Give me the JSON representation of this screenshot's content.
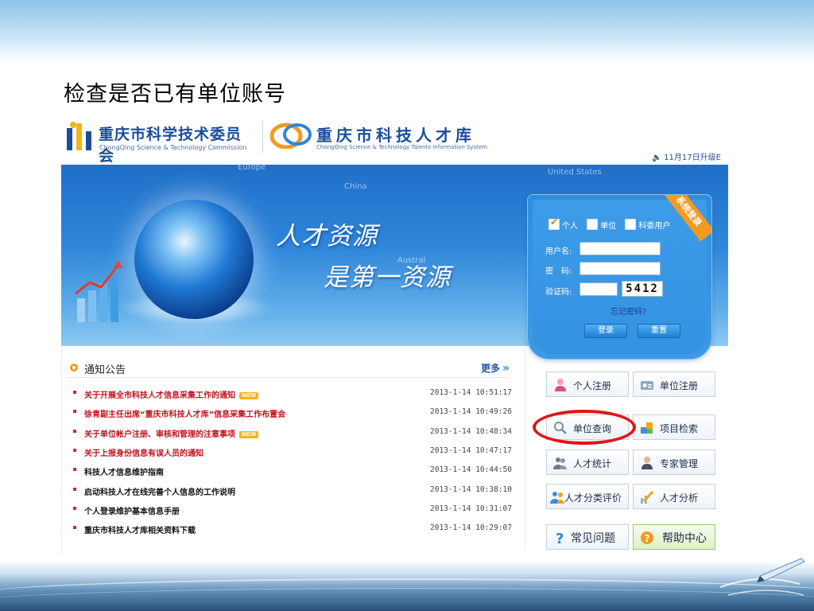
{
  "slide": {
    "title": "检查是否已有单位账号"
  },
  "header": {
    "logo1": {
      "name": "重庆市科学技术委员会",
      "en": "ChongQing Science & Technology Commission"
    },
    "logo2": {
      "name": "重庆市科技人才库",
      "en": "ChongQing Science & Technology Talents Information System"
    },
    "upgrade_notice": "11月17日升级E"
  },
  "banner": {
    "slogan_line1": "人才资源",
    "slogan_line2": "是第一资源",
    "map_labels": [
      "Europe",
      "China",
      "United States",
      "Austral"
    ]
  },
  "login": {
    "ribbon": "系统登录",
    "roles": [
      {
        "label": "个人",
        "checked": true
      },
      {
        "label": "单位",
        "checked": false
      },
      {
        "label": "科委用户",
        "checked": false
      }
    ],
    "username_label": "用户名:",
    "password_label": "密　码:",
    "captcha_label": "验证码:",
    "captcha_code": "5412",
    "forgot": "忘记密码?",
    "login_button": "登录",
    "reset_button": "重置"
  },
  "notices": {
    "title": "通知公告",
    "more": "更多",
    "items": [
      {
        "text": "关于开展全市科技人才信息采集工作的通知",
        "date": "2013-1-14 10:51:17",
        "new": true,
        "red": true
      },
      {
        "text": "徐青副主任出席“重庆市科技人才库”信息采集工作布置会",
        "date": "2013-1-14 10:49:26",
        "new": false,
        "red": true
      },
      {
        "text": "关于单位帐户注册、审核和管理的注意事项",
        "date": "2013-1-14 10:48:34",
        "new": true,
        "red": true
      },
      {
        "text": "关于上报身份信息有误人员的通知",
        "date": "2013-1-14 10:47:17",
        "new": false,
        "red": true
      },
      {
        "text": "科技人才信息维护指南",
        "date": "2013-1-14 10:44:50",
        "new": false,
        "red": false
      },
      {
        "text": "启动科技人才在线完善个人信息的工作说明",
        "date": "2013-1-14 10:38:10",
        "new": false,
        "red": false
      },
      {
        "text": "个人登录维护基本信息手册",
        "date": "2013-1-14 10:31:07",
        "new": false,
        "red": false
      },
      {
        "text": "重庆市科技人才库相关资料下载",
        "date": "2013-1-14 10:29:07",
        "new": false,
        "red": false
      }
    ],
    "new_badge": "NEW"
  },
  "quick": {
    "personal_register": "个人注册",
    "unit_register": "单位注册",
    "unit_query": "单位查询",
    "project_search": "项目检索",
    "talent_stats": "人才统计",
    "expert_manage": "专家管理",
    "talent_eval": "人才分类评价",
    "talent_analysis": "人才分析",
    "faq": "常见问题",
    "help": "帮助中心"
  },
  "colors": {
    "accent_orange": "#f39a1f",
    "banner_blue": "#2f86da",
    "notice_red": "#c1121f",
    "highlight_red": "#e01515"
  }
}
